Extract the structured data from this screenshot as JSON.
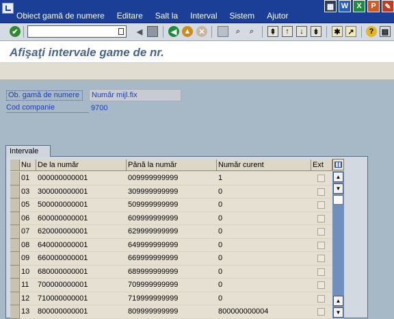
{
  "menu": [
    "Obiect gamă de numere",
    "Editare",
    "Salt la",
    "Interval",
    "Sistem",
    "Ajutor"
  ],
  "window_icons": [
    "toolbar-grid-icon",
    "word-icon",
    "excel-icon",
    "powerpoint-icon",
    "close-icon"
  ],
  "window_icon_glyphs": [
    "▦",
    "W",
    "X",
    "P",
    "✎"
  ],
  "toolbar": {
    "command_field_value": "",
    "buttons": [
      "enter-icon",
      "back-arrow-icon",
      "save-icon",
      "back-icon",
      "exit-icon",
      "cancel-icon",
      "print-icon",
      "find-icon",
      "find-next-icon",
      "first-page-icon",
      "previous-page-icon",
      "next-page-icon",
      "last-page-icon",
      "create-session-icon",
      "shortcut-icon",
      "help-icon",
      "layout-menu-icon"
    ]
  },
  "page_title": "Afişaţi intervale game de nr.",
  "fields": {
    "object_label": "Ob. gamă de numere",
    "object_value": "Număr mijl.fix",
    "company_label": "Cod companie",
    "company_value": "9700"
  },
  "tab_label": "Intervale",
  "table": {
    "columns": [
      "Nu",
      "De la număr",
      "Până la număr",
      "Număr curent",
      "Ext"
    ],
    "rows": [
      {
        "nu": "01",
        "from": "000000000001",
        "to": "009999999999",
        "current": "1"
      },
      {
        "nu": "03",
        "from": "300000000001",
        "to": "309999999999",
        "current": "0"
      },
      {
        "nu": "05",
        "from": "500000000001",
        "to": "509999999999",
        "current": "0"
      },
      {
        "nu": "06",
        "from": "600000000001",
        "to": "609999999999",
        "current": "0"
      },
      {
        "nu": "07",
        "from": "620000000001",
        "to": "629999999999",
        "current": "0"
      },
      {
        "nu": "08",
        "from": "640000000001",
        "to": "649999999999",
        "current": "0"
      },
      {
        "nu": "09",
        "from": "660000000001",
        "to": "669999999999",
        "current": "0"
      },
      {
        "nu": "10",
        "from": "680000000001",
        "to": "689999999999",
        "current": "0"
      },
      {
        "nu": "11",
        "from": "700000000001",
        "to": "709999999999",
        "current": "0"
      },
      {
        "nu": "12",
        "from": "710000000001",
        "to": "719999999999",
        "current": "0"
      },
      {
        "nu": "13",
        "from": "800000000001",
        "to": "809999999999",
        "current": "800000000004"
      }
    ]
  },
  "colors": {
    "menubar": "#1b3f96",
    "title": "#47638c",
    "label": "#1a3fb6",
    "background": "#a7b8c6"
  }
}
